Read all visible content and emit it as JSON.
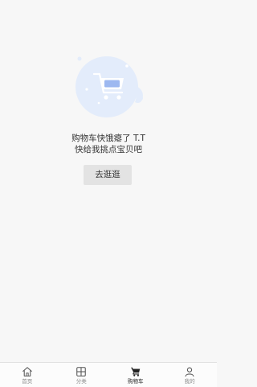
{
  "empty_state": {
    "line1": "购物车快饿瘪了 T.T",
    "line2": "快给我挑点宝贝吧",
    "button_label": "去逛逛",
    "illustration": "shopping-cart-illustration"
  },
  "tabbar": {
    "active": "cart",
    "tabs": [
      {
        "id": "home",
        "label": "首页",
        "icon": "home-icon"
      },
      {
        "id": "category",
        "label": "分类",
        "icon": "grid-icon"
      },
      {
        "id": "cart",
        "label": "购物车",
        "icon": "cart-icon"
      },
      {
        "id": "mine",
        "label": "我的",
        "icon": "user-icon"
      }
    ]
  },
  "colors": {
    "background": "#f7f7f7",
    "illustration_circle": "#e3ecfb",
    "illustration_accent": "#9db8f0",
    "button_bg": "#e3e3e3",
    "tab_active": "#222222",
    "tab_inactive": "#8a8a8a"
  }
}
